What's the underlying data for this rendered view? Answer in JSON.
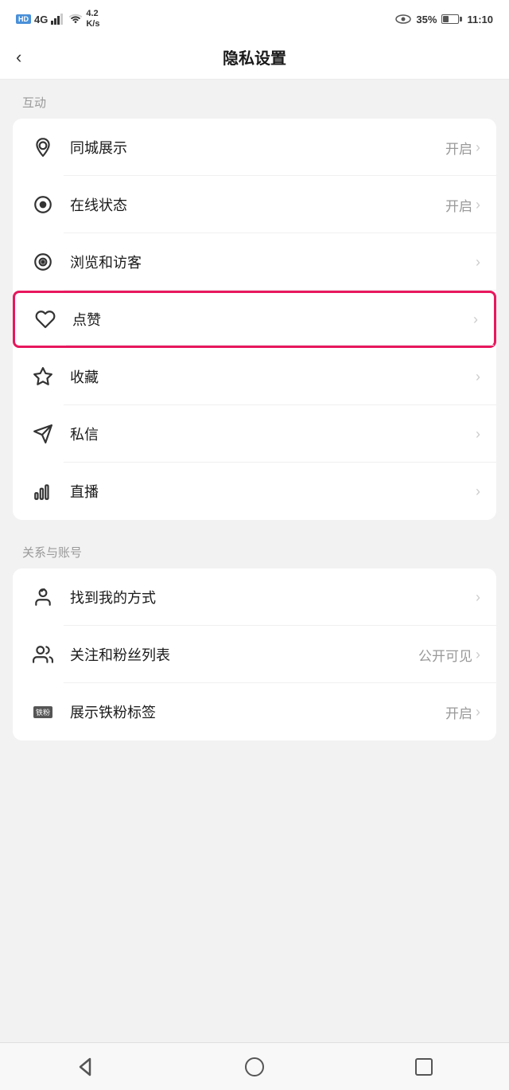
{
  "statusBar": {
    "left": {
      "hd": "HD",
      "signal": "4G",
      "speed": "4.2\nK/s"
    },
    "right": {
      "battery": "35%",
      "time": "11:10"
    }
  },
  "navBar": {
    "backLabel": "‹",
    "title": "隐私设置"
  },
  "sections": [
    {
      "label": "互动",
      "items": [
        {
          "icon": "location",
          "label": "同城展示",
          "value": "开启",
          "hasChevron": true,
          "highlighted": false
        },
        {
          "icon": "online",
          "label": "在线状态",
          "value": "开启",
          "hasChevron": true,
          "highlighted": false
        },
        {
          "icon": "browse",
          "label": "浏览和访客",
          "value": "",
          "hasChevron": true,
          "highlighted": false
        },
        {
          "icon": "like",
          "label": "点赞",
          "value": "",
          "hasChevron": true,
          "highlighted": true
        },
        {
          "icon": "collect",
          "label": "收藏",
          "value": "",
          "hasChevron": true,
          "highlighted": false
        },
        {
          "icon": "message",
          "label": "私信",
          "value": "",
          "hasChevron": true,
          "highlighted": false
        },
        {
          "icon": "live",
          "label": "直播",
          "value": "",
          "hasChevron": true,
          "highlighted": false
        }
      ]
    },
    {
      "label": "关系与账号",
      "items": [
        {
          "icon": "findme",
          "label": "找到我的方式",
          "value": "",
          "hasChevron": true,
          "highlighted": false
        },
        {
          "icon": "follow",
          "label": "关注和粉丝列表",
          "value": "公开可见",
          "hasChevron": true,
          "highlighted": false
        },
        {
          "icon": "ironfan",
          "label": "展示铁粉标签",
          "value": "开启",
          "hasChevron": true,
          "highlighted": false
        }
      ]
    }
  ],
  "bottomNav": {
    "back": "◁",
    "home": "○",
    "recent": "□"
  }
}
